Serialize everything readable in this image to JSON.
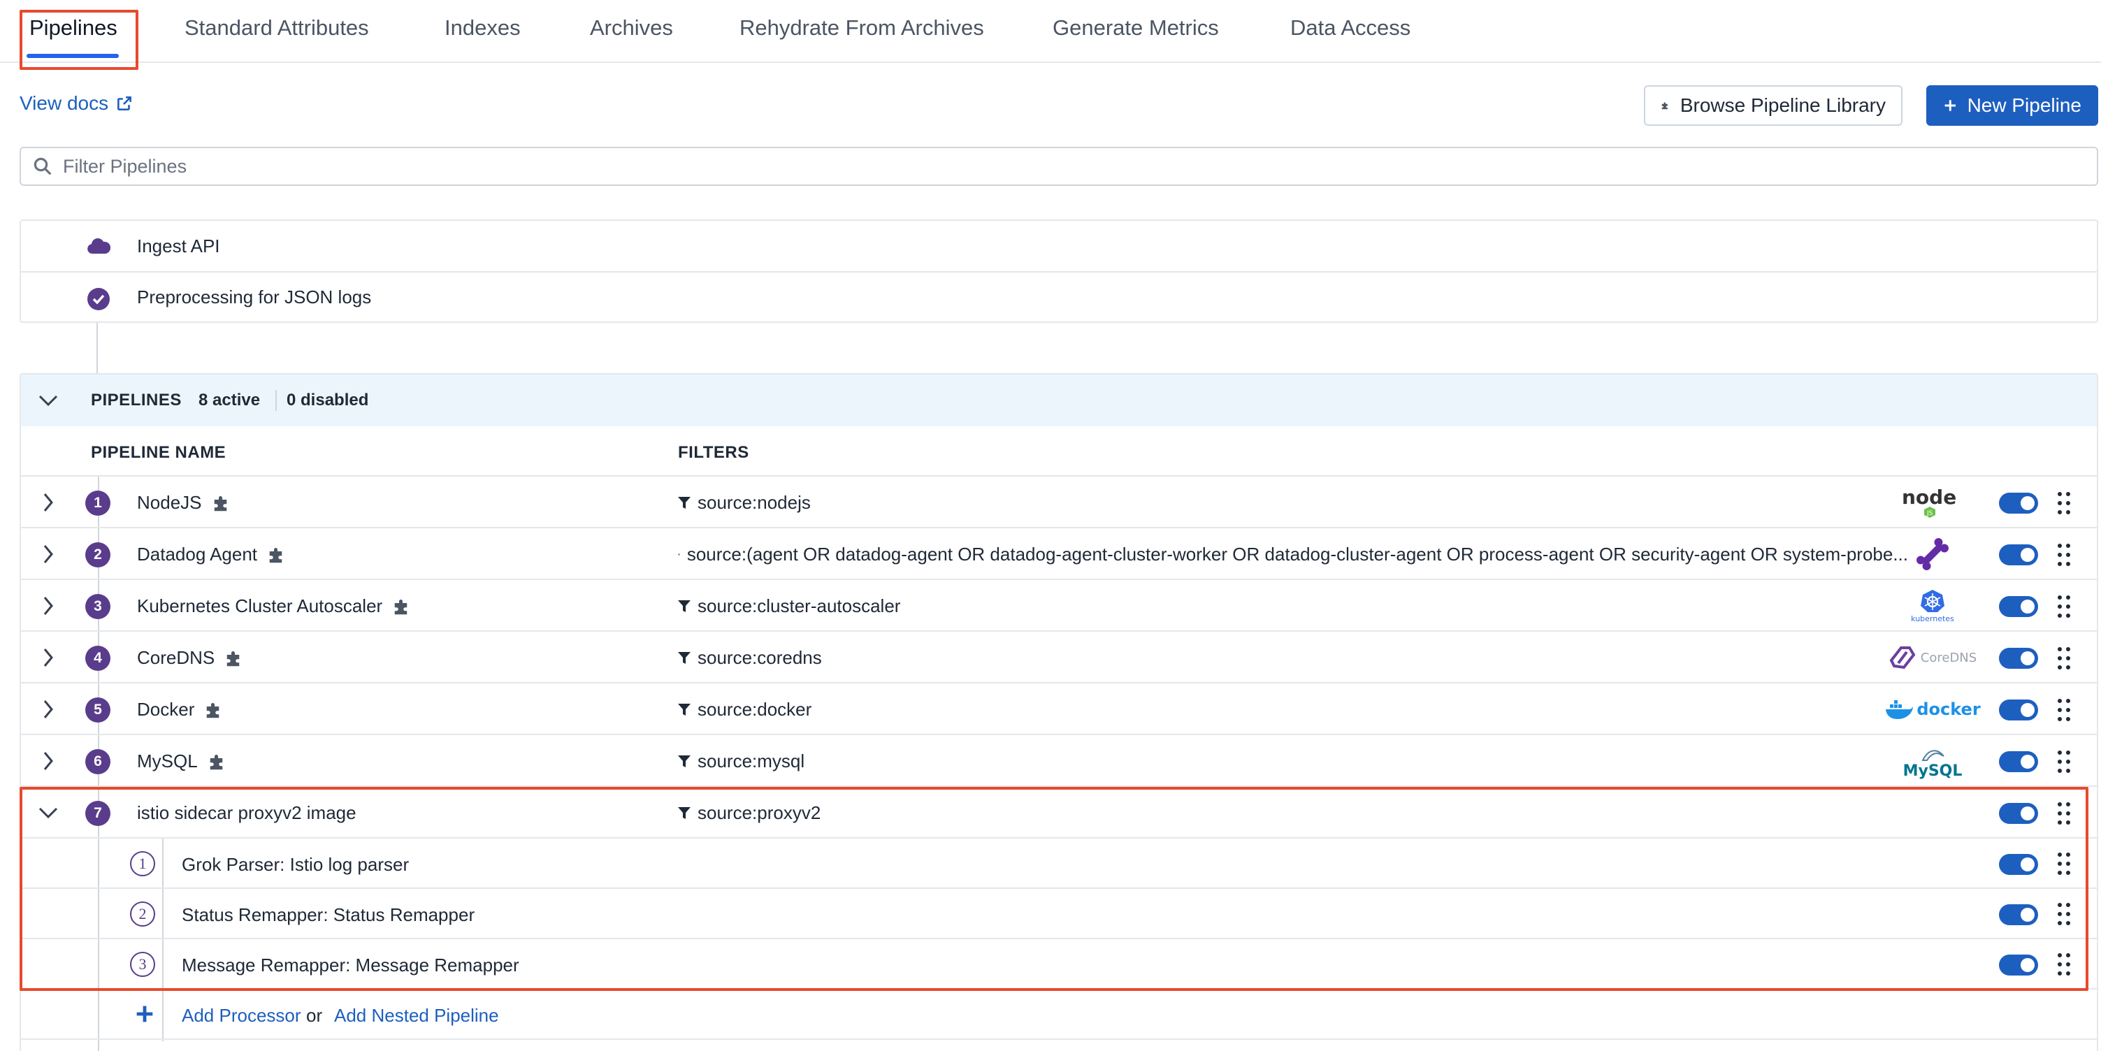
{
  "tabs": [
    {
      "label": "Pipelines",
      "active": true
    },
    {
      "label": "Standard Attributes"
    },
    {
      "label": "Indexes"
    },
    {
      "label": "Archives"
    },
    {
      "label": "Rehydrate From Archives"
    },
    {
      "label": "Generate Metrics"
    },
    {
      "label": "Data Access"
    }
  ],
  "docs_link": "View docs",
  "buttons": {
    "library": "Browse Pipeline Library",
    "new_pipeline": "New Pipeline"
  },
  "filter": {
    "placeholder": "Filter Pipelines"
  },
  "preprocessing": [
    {
      "label": "Ingest API",
      "icon": "cloud-icon"
    },
    {
      "label": "Preprocessing for JSON logs",
      "icon": "check-circle-icon"
    }
  ],
  "pipelines_section": {
    "title": "PIPELINES",
    "active": "8 active",
    "disabled": "0 disabled",
    "col_name": "PIPELINE NAME",
    "col_filters": "FILTERS"
  },
  "pipelines": [
    {
      "num": "1",
      "name": "NodeJS",
      "filter": "source:nodejs",
      "logo": "nodejs-logo"
    },
    {
      "num": "2",
      "name": "Datadog Agent",
      "filter": "source:(agent OR datadog-agent OR datadog-agent-cluster-worker OR datadog-cluster-agent OR process-agent OR security-agent OR system-probe...",
      "logo": "datadog-bone-logo"
    },
    {
      "num": "3",
      "name": "Kubernetes Cluster Autoscaler",
      "filter": "source:cluster-autoscaler",
      "logo": "kubernetes-logo",
      "logo_text": "kubernetes"
    },
    {
      "num": "4",
      "name": "CoreDNS",
      "filter": "source:coredns",
      "logo": "coredns-logo",
      "logo_text": "CoreDNS"
    },
    {
      "num": "5",
      "name": "Docker",
      "filter": "source:docker",
      "logo": "docker-logo",
      "logo_text": "docker"
    },
    {
      "num": "6",
      "name": "MySQL",
      "filter": "source:mysql",
      "logo": "mysql-logo",
      "logo_text": "MySQL"
    },
    {
      "num": "7",
      "name": "istio sidecar proxyv2 image",
      "filter": "source:proxyv2",
      "expanded": true
    }
  ],
  "processors": [
    {
      "num": "1",
      "name": "Grok Parser: Istio log parser"
    },
    {
      "num": "2",
      "name": "Status Remapper: Status Remapper"
    },
    {
      "num": "3",
      "name": "Message Remapper: Message Remapper"
    }
  ],
  "add": {
    "processor": "Add Processor",
    "or": "or",
    "nested": "Add Nested Pipeline"
  },
  "colors": {
    "accent": "#1d5fbf",
    "purple": "#5a3c8c",
    "highlight": "#e64a2e"
  }
}
